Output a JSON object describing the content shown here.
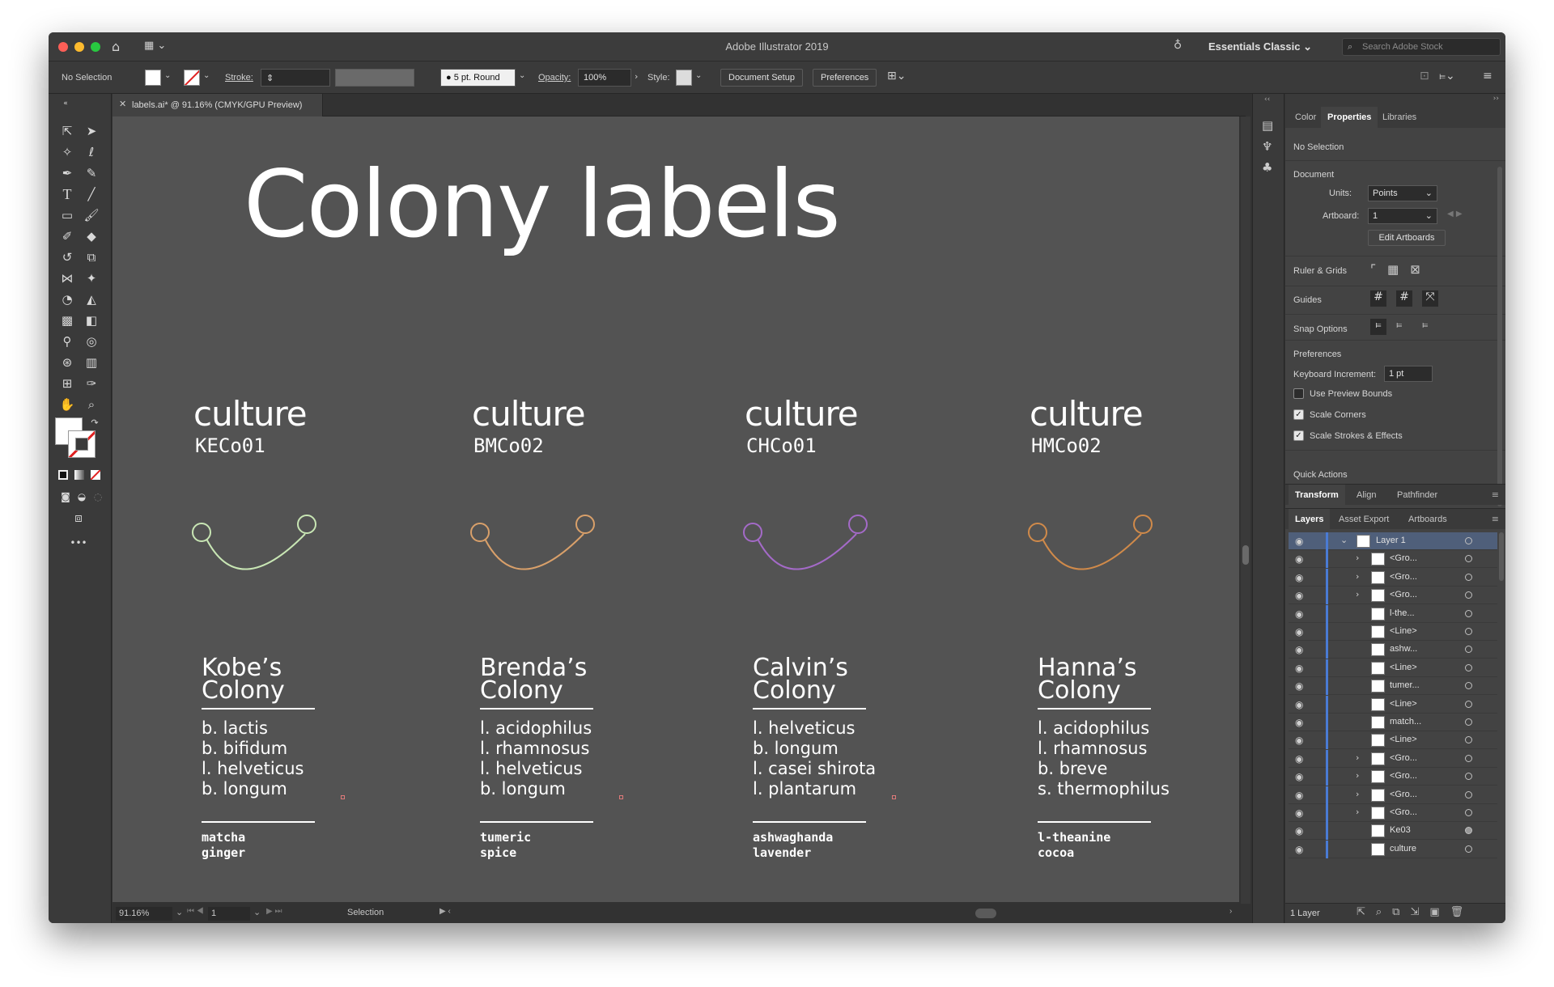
{
  "app": {
    "title": "Adobe Illustrator 2019",
    "workspace": "Essentials Classic",
    "search_placeholder": "Search Adobe Stock"
  },
  "control_bar": {
    "selection": "No Selection",
    "stroke_label": "Stroke:",
    "brush": "5 pt. Round",
    "opacity_label": "Opacity:",
    "opacity_value": "100%",
    "style_label": "Style:",
    "document_setup": "Document Setup",
    "preferences": "Preferences"
  },
  "document": {
    "tab": "labels.ai* @ 91.16% (CMYK/GPU Preview)",
    "zoom": "91.16%",
    "artboard": "1",
    "status": "Selection"
  },
  "artwork": {
    "title": "Colony labels",
    "labels": [
      {
        "culture": "culture",
        "code": "KECo01",
        "colony": "Kobe’s\nColony",
        "strains": [
          "b. lactis",
          "b. bifidum",
          "l. helveticus",
          "b. longum"
        ],
        "flavors": [
          "matcha",
          "ginger"
        ],
        "color": "#c8e6b4"
      },
      {
        "culture": "culture",
        "code": "BMCo02",
        "colony": "Brenda’s\nColony",
        "strains": [
          "l. acidophilus",
          "l. rhamnosus",
          "l. helveticus",
          "b. longum"
        ],
        "flavors": [
          "tumeric",
          "spice"
        ],
        "color": "#d9a06a"
      },
      {
        "culture": "culture",
        "code": "CHCo01",
        "colony": "Calvin’s\nColony",
        "strains": [
          "l. helveticus",
          "b. longum",
          "l. casei shirota",
          "l. plantarum"
        ],
        "flavors": [
          "ashwaghanda",
          "lavender"
        ],
        "color": "#a46ac8"
      },
      {
        "culture": "culture",
        "code": "HMCo02",
        "colony": "Hanna’s\nColony",
        "strains": [
          "l. acidophilus",
          "l. rhamnosus",
          "b. breve",
          "s. thermophilus"
        ],
        "flavors": [
          "l-theanine",
          "cocoa"
        ],
        "color": "#d08a4a"
      }
    ]
  },
  "properties_panel": {
    "tabs": [
      "Color",
      "Properties",
      "Libraries"
    ],
    "active_tab": "Properties",
    "selection": "No Selection",
    "document_heading": "Document",
    "units_label": "Units:",
    "units_value": "Points",
    "artboard_label": "Artboard:",
    "artboard_value": "1",
    "edit_artboards": "Edit Artboards",
    "ruler_grids": "Ruler & Grids",
    "guides": "Guides",
    "snap_options": "Snap Options",
    "preferences_heading": "Preferences",
    "keyboard_increment_label": "Keyboard Increment:",
    "keyboard_increment_value": "1 pt",
    "use_preview_bounds": "Use Preview Bounds",
    "scale_corners": "Scale Corners",
    "scale_strokes": "Scale Strokes & Effects",
    "quick_actions": "Quick Actions"
  },
  "transform_tabs": [
    "Transform",
    "Align",
    "Pathfinder"
  ],
  "layers_panel": {
    "tabs": [
      "Layers",
      "Asset Export",
      "Artboards"
    ],
    "layers": [
      {
        "name": "Layer 1",
        "expand": "⌄"
      },
      {
        "name": "<Gro...",
        "expand": "›"
      },
      {
        "name": "<Gro...",
        "expand": "›"
      },
      {
        "name": "<Gro...",
        "expand": "›"
      },
      {
        "name": "l-the...",
        "expand": ""
      },
      {
        "name": "<Line>",
        "expand": ""
      },
      {
        "name": "ashw...",
        "expand": ""
      },
      {
        "name": "<Line>",
        "expand": ""
      },
      {
        "name": "tumer...",
        "expand": ""
      },
      {
        "name": "<Line>",
        "expand": ""
      },
      {
        "name": "match...",
        "expand": ""
      },
      {
        "name": "<Line>",
        "expand": ""
      },
      {
        "name": "<Gro...",
        "expand": "›"
      },
      {
        "name": "<Gro...",
        "expand": "›"
      },
      {
        "name": "<Gro...",
        "expand": "›"
      },
      {
        "name": "<Gro...",
        "expand": "›"
      },
      {
        "name": "Ke03",
        "expand": ""
      },
      {
        "name": "culture",
        "expand": ""
      }
    ],
    "footer": "1 Layer"
  },
  "colors": {
    "traffic_red": "#fe5f57",
    "traffic_yellow": "#febb2e",
    "traffic_green": "#28c840",
    "canvas": "#535353",
    "layer_highlight": "#4a7bd4"
  }
}
